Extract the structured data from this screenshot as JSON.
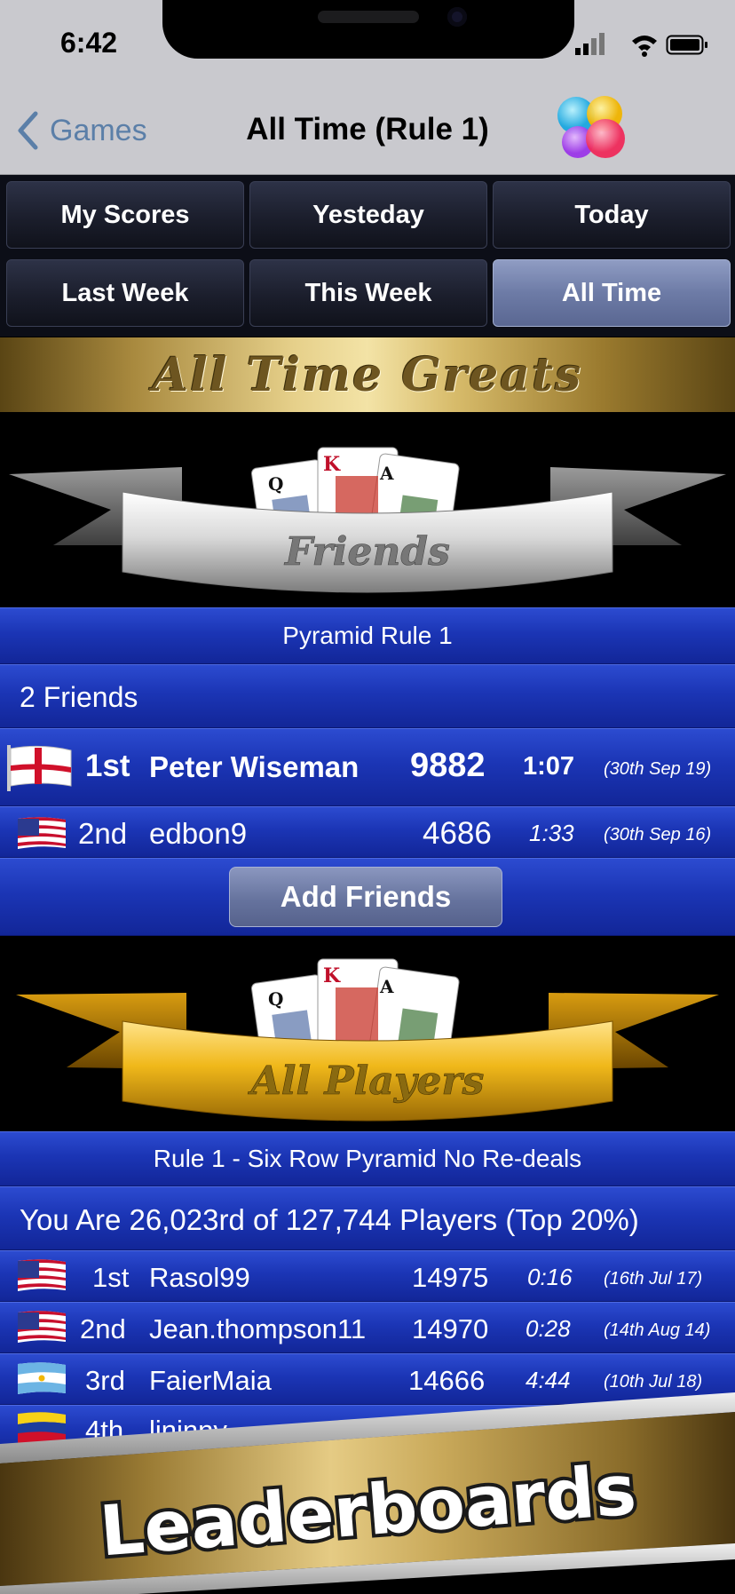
{
  "status": {
    "time": "6:42"
  },
  "nav": {
    "back_label": "Games",
    "title": "All Time (Rule 1)"
  },
  "tabs": [
    {
      "label": "My Scores",
      "active": false
    },
    {
      "label": "Yesteday",
      "active": false
    },
    {
      "label": "Today",
      "active": false
    },
    {
      "label": "Last Week",
      "active": false
    },
    {
      "label": "This Week",
      "active": false
    },
    {
      "label": "All Time",
      "active": true
    }
  ],
  "banner": {
    "title": "All Time Greats"
  },
  "friends": {
    "ribbon_label": "Friends",
    "subtitle": "Pyramid Rule 1",
    "count_label": "2 Friends",
    "rows": [
      {
        "flag": "england-flag-icon",
        "rank": "1st",
        "name": "Peter Wiseman",
        "score": "9882",
        "time": "1:07",
        "date": "(30th Sep 19)"
      },
      {
        "flag": "usa-flag-icon",
        "rank": "2nd",
        "name": "edbon9",
        "score": "4686",
        "time": "1:33",
        "date": "(30th Sep 16)"
      }
    ],
    "add_button": "Add Friends"
  },
  "players": {
    "ribbon_label": "All Players",
    "subtitle": "Rule 1 - Six Row Pyramid No Re-deals",
    "position_label": "You Are 26,023rd of 127,744 Players (Top 20%)",
    "rows": [
      {
        "flag": "usa-flag-icon",
        "rank": "1st",
        "name": "Rasol99",
        "score": "14975",
        "time": "0:16",
        "date": "(16th Jul 17)"
      },
      {
        "flag": "usa-flag-icon",
        "rank": "2nd",
        "name": "Jean.thompson11",
        "score": "14970",
        "time": "0:28",
        "date": "(14th Aug 14)"
      },
      {
        "flag": "argentina-flag-icon",
        "rank": "3rd",
        "name": "FaierMaia",
        "score": "14666",
        "time": "4:44",
        "date": "(10th Jul 18)"
      },
      {
        "flag": "venezuela-flag-icon",
        "rank": "4th",
        "name": "lininny",
        "score": "",
        "time": "",
        "date": ""
      }
    ]
  },
  "promo": {
    "title": "Leaderboards"
  },
  "colors": {
    "row_blue": "#1b35b5",
    "gold": "#d7bb6a",
    "tab_active": "#6d7ba6"
  }
}
